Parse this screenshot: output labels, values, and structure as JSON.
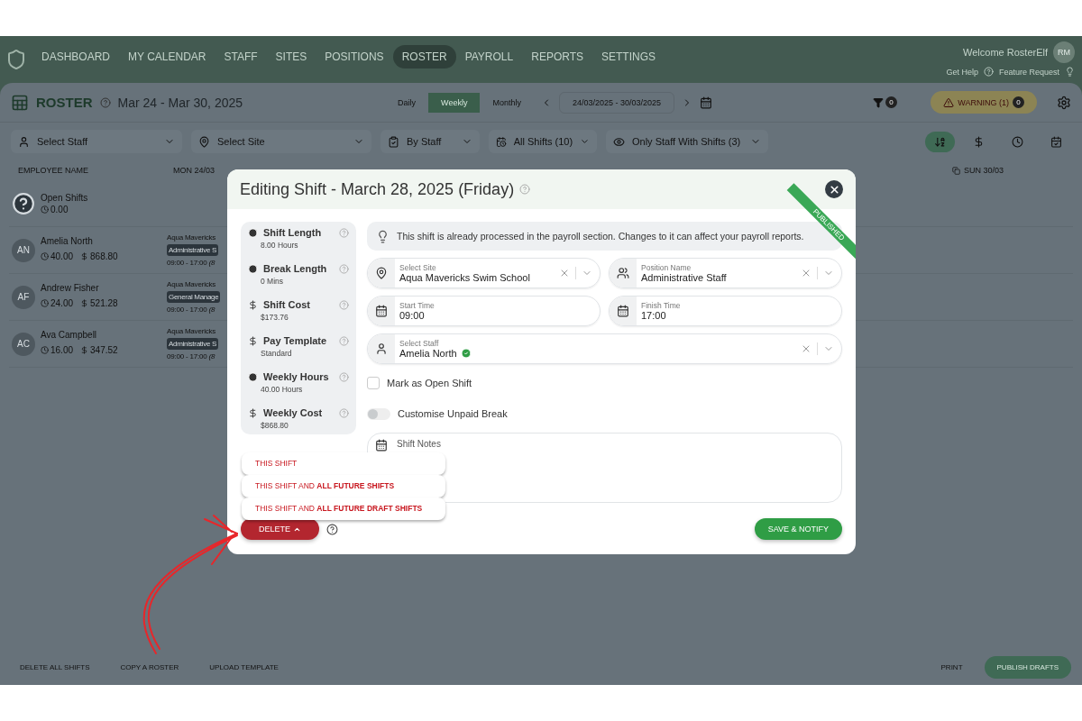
{
  "nav": {
    "items": [
      {
        "label": "DASHBOARD",
        "selected": false
      },
      {
        "label": "MY CALENDAR",
        "selected": false
      },
      {
        "label": "STAFF",
        "selected": false
      },
      {
        "label": "SITES",
        "selected": false
      },
      {
        "label": "POSITIONS",
        "selected": false
      },
      {
        "label": "ROSTER",
        "selected": true
      },
      {
        "label": "PAYROLL",
        "selected": false
      },
      {
        "label": "REPORTS",
        "selected": false
      },
      {
        "label": "SETTINGS",
        "selected": false
      }
    ],
    "welcome": "Welcome RosterElf",
    "avatar": "RM",
    "help": "Get Help",
    "feature": "Feature Request"
  },
  "toolbar": {
    "title": "ROSTER",
    "range": "Mar 24 - Mar 30, 2025",
    "views": [
      {
        "label": "Daily",
        "selected": false
      },
      {
        "label": "Weekly",
        "selected": true
      },
      {
        "label": "Monthly",
        "selected": false
      }
    ],
    "date_range": "24/03/2025 - 30/03/2025",
    "filter_count": "0",
    "warning": "WARNING (1)",
    "warning_count": "0"
  },
  "filters": {
    "staff_placeholder": "Select Staff",
    "site_placeholder": "Select Site",
    "group": "By Staff",
    "shifts": "All Shifts (10)",
    "visibility": "Only Staff With Shifts (3)"
  },
  "table": {
    "columns": [
      "EMPLOYEE NAME",
      "MON 24/03",
      "SUN 30/03"
    ],
    "open_shifts": {
      "label": "Open Shifts",
      "hours": "0.00"
    },
    "rows": [
      {
        "initials": "AN",
        "name": "Amelia North",
        "hours": "40.00",
        "cost": "868.80",
        "shift": {
          "site": "Aqua Mavericks",
          "position": "Administrative S",
          "time": "09:00 - 17:00 *(8*"
        }
      },
      {
        "initials": "AF",
        "name": "Andrew Fisher",
        "hours": "24.00",
        "cost": "521.28",
        "shift": {
          "site": "Aqua Mavericks",
          "position": "General Manage",
          "time": "09:00 - 17:00 *(8*"
        }
      },
      {
        "initials": "AC",
        "name": "Ava Campbell",
        "hours": "16.00",
        "cost": "347.52",
        "shift": {
          "site": "Aqua Mavericks",
          "position": "Administrative S",
          "time": "09:00 - 17:00 *(8*"
        }
      }
    ]
  },
  "footer": {
    "left": [
      "DELETE ALL SHIFTS",
      "COPY A ROSTER",
      "UPLOAD TEMPLATE"
    ],
    "print": "PRINT",
    "publish": "PUBLISH DRAFTS"
  },
  "modal": {
    "title": "Editing Shift - March 28, 2025 (Friday)",
    "ribbon": "PUBLISHED",
    "summary": [
      {
        "kind": "time",
        "label": "Shift Length",
        "value": "8.00 Hours"
      },
      {
        "kind": "time",
        "label": "Break Length",
        "value": "0 Mins"
      },
      {
        "kind": "money",
        "label": "Shift Cost",
        "value": "$173.76"
      },
      {
        "kind": "money",
        "label": "Pay Template",
        "value": "Standard"
      },
      {
        "kind": "time",
        "label": "Weekly Hours",
        "value": "40.00 Hours"
      },
      {
        "kind": "money",
        "label": "Weekly Cost",
        "value": "$868.80"
      }
    ],
    "notice": "This shift is already processed in the payroll section. Changes to it can affect your payroll reports.",
    "fields": [
      {
        "kind": "site",
        "label": "Select Site",
        "value": "Aqua Mavericks Swim School"
      },
      {
        "kind": "position",
        "label": "Position Name",
        "value": "Administrative Staff"
      },
      {
        "kind": "start",
        "label": "Start Time",
        "value": "09:00"
      },
      {
        "kind": "finish",
        "label": "Finish Time",
        "value": "17:00"
      },
      {
        "kind": "staff",
        "label": "Select Staff",
        "value": "Amelia North",
        "verified": true
      }
    ],
    "open_shift": {
      "label": "Mark as Open Shift",
      "checked": false
    },
    "unpaid_break": {
      "label": "Customise Unpaid Break",
      "on": false
    },
    "notes": {
      "placeholder": "Shift Notes"
    },
    "delete": {
      "label": "DELETE",
      "expanded": true,
      "options": [
        "THIS SHIFT",
        "THIS SHIFT AND **ALL FUTURE SHIFTS**",
        "THIS SHIFT AND **ALL FUTURE DRAFT SHIFTS**"
      ]
    },
    "save": "SAVE & NOTIFY"
  }
}
